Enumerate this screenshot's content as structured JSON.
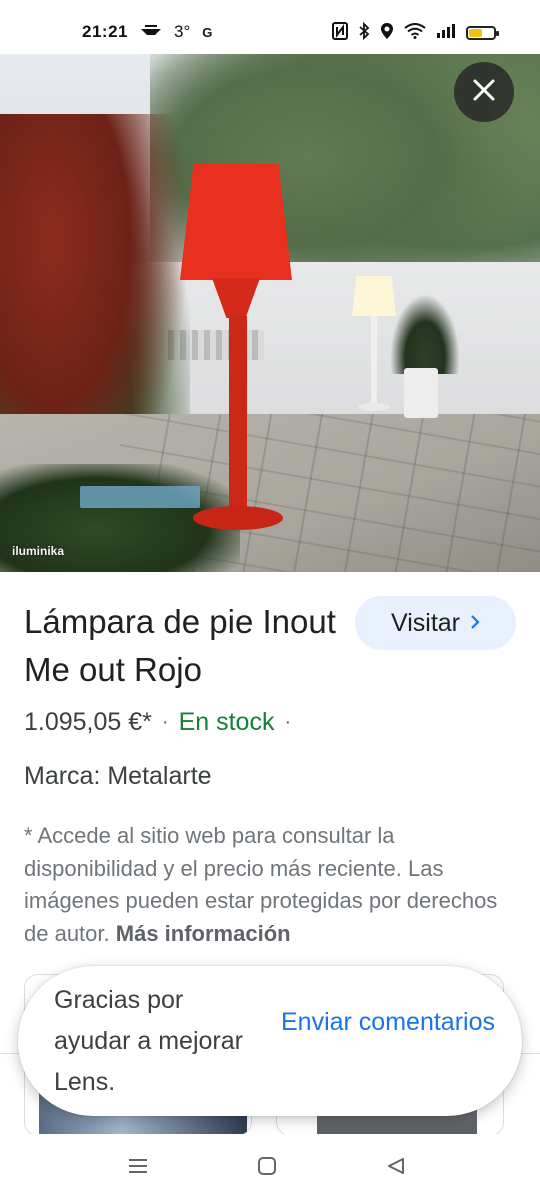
{
  "status_bar": {
    "time": "21:21",
    "temperature": "3°",
    "network_letter": "G",
    "battery_level": 0.55
  },
  "hero": {
    "watermark": "iluminika",
    "close_icon": "close-icon"
  },
  "product": {
    "title": "Lámpara de pie Inout Me out Rojo",
    "visit_label": "Visitar",
    "price": "1.095,05 €*",
    "separator": "·",
    "availability": "En stock",
    "brand": "Marca: Metalarte",
    "disclaimer": "* Accede al sitio web para consultar la disponibilidad y el precio más reciente. Las imágenes pueden estar protegidas por derechos de autor.",
    "more_info": "Más información"
  },
  "toast": {
    "message": "Gracias por ayudar a mejorar Lens.",
    "action": "Enviar comentarios"
  },
  "colors": {
    "accent": "#1a73e8",
    "stock_green": "#188038",
    "visit_bg": "#e8f0fe",
    "lamp_red": "#e8301e"
  }
}
